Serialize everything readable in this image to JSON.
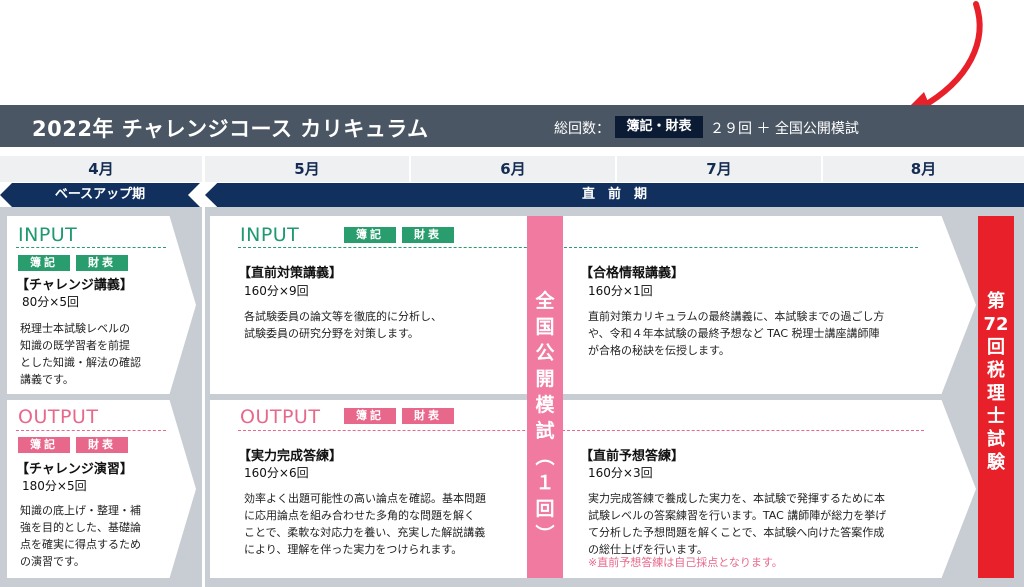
{
  "header": {
    "title": "2022年 チャレンジコース カリキュラム",
    "total_label": "総回数：",
    "total_badge": "簿記・財表",
    "total_rest": "２９回 ＋ 全国公開模試"
  },
  "months": [
    "4月",
    "5月",
    "6月",
    "7月",
    "8月"
  ],
  "periods": {
    "base": "ベースアップ期",
    "pre_exam": "直　前　期"
  },
  "left_input": {
    "title": "INPUT",
    "tags": [
      "簿記",
      "財表"
    ],
    "heading": "【チャレンジ講義】",
    "schedule": "80分×5回",
    "desc": [
      "税理士本試験レベルの",
      "知識の既学習者を前提",
      "とした知識・解法の確認",
      "講義です。"
    ]
  },
  "left_output": {
    "title": "OUTPUT",
    "tags": [
      "簿記",
      "財表"
    ],
    "heading": "【チャレンジ演習】",
    "schedule": "180分×5回",
    "desc": [
      "知識の底上げ・整理・補",
      "強を目的とした、基礎論",
      "点を確実に得点するため",
      "の演習です。"
    ]
  },
  "main_input": {
    "title": "INPUT",
    "tags": [
      "簿記",
      "財表"
    ],
    "a_heading": "【直前対策講義】",
    "a_schedule": "160分×9回",
    "a_desc": [
      "各試験委員の論文等を徹底的に分析し、",
      "試験委員の研究分野を対策します。"
    ],
    "b_heading": "【合格情報講義】",
    "b_schedule": "160分×1回",
    "b_desc": [
      "直前対策カリキュラムの最終講義に、本試験までの過ごし方",
      "や、令和４年本試験の最終予想など TAC 税理士講座講師陣",
      "が合格の秘訣を伝授します。"
    ]
  },
  "main_output": {
    "title": "OUTPUT",
    "tags": [
      "簿記",
      "財表"
    ],
    "a_heading": "【実力完成答練】",
    "a_schedule": "160分×6回",
    "a_desc": [
      "効率よく出題可能性の高い論点を確認。基本問題",
      "に応用論点を組み合わせた多角的な問題を解く",
      "ことで、柔軟な対応力を養い、充実した解説講義",
      "により、理解を伴った実力をつけられます。"
    ],
    "b_heading": "【直前予想答練】",
    "b_schedule": "160分×3回",
    "b_desc": [
      "実力完成答練で養成した実力を、本試験で発揮するために本",
      "試験レベルの答案練習を行います。TAC 講師陣が総力を挙げ",
      "て分析した予想問題を解くことで、本試験へ向けた答案作成",
      "の総仕上げを行います。"
    ],
    "b_note": "※直前予想答練は自己採点となります。"
  },
  "mock_column": [
    "全",
    "国",
    "公",
    "開",
    "模",
    "試",
    "︵",
    "１",
    "回",
    "︶"
  ],
  "exam_column": [
    "第",
    "72",
    "回",
    "税",
    "理",
    "士",
    "試",
    "験"
  ],
  "colors": {
    "bar": "#12305e",
    "input": "#2a9d6e",
    "output": "#e8688c",
    "mock": "#f07aa0",
    "exam": "#e8202a",
    "arrow": "#e8202a"
  }
}
